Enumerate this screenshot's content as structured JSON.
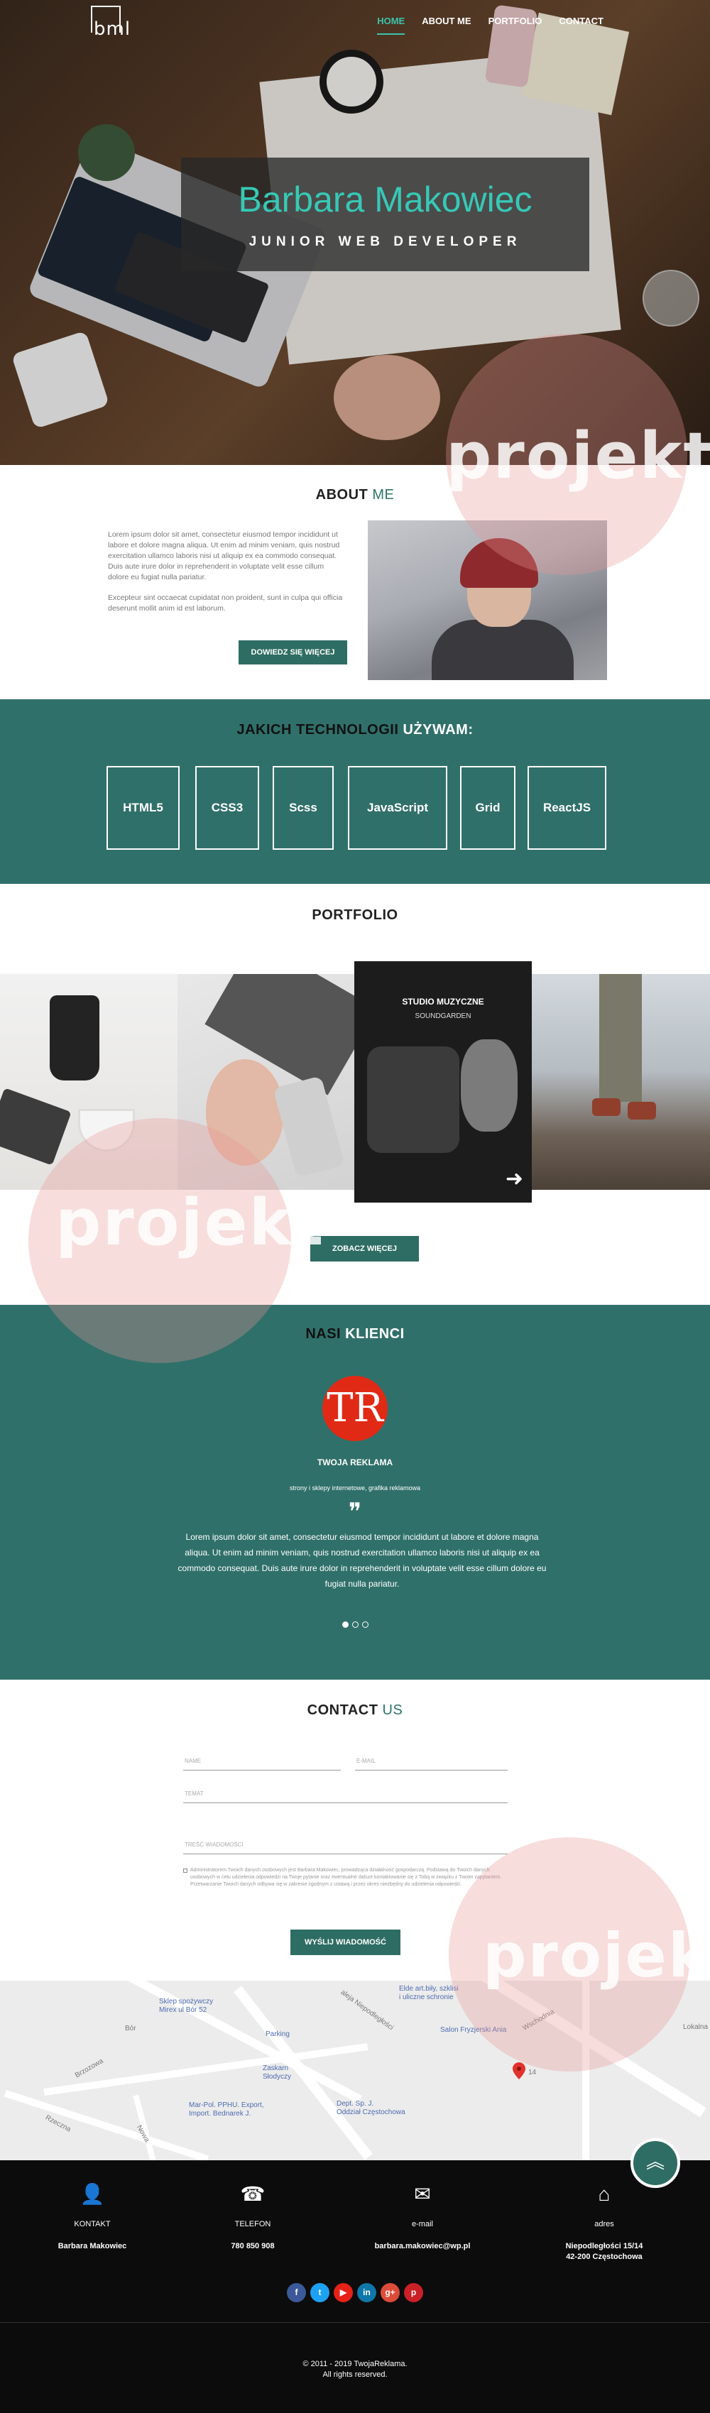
{
  "brand": {
    "logo_text": "bml"
  },
  "nav": {
    "items": [
      {
        "label": "HOME",
        "active": true
      },
      {
        "label": "ABOUT ME",
        "active": false
      },
      {
        "label": "PORTFOLIO",
        "active": false
      },
      {
        "label": "CONTACT",
        "active": false
      }
    ]
  },
  "hero": {
    "name": "Barbara Makowiec",
    "role": "JUNIOR WEB DEVELOPER"
  },
  "watermark": {
    "text": "projekt"
  },
  "about": {
    "title_main": "ABOUT",
    "title_accent": "ME",
    "paragraph_1": "Lorem ipsum dolor sit amet, consectetur eiusmod tempor incididunt ut labore et dolore magna aliqua. Ut enim ad minim veniam, quis nostrud exercitation ullamco laboris nisi ut aliquip ex ea commodo consequat. Duis aute irure dolor in reprehenderit in voluptate velit esse cillum dolore eu fugiat nulla pariatur.",
    "paragraph_2": "Excepteur sint occaecat cupidatat non proident, sunt in culpa qui officia deserunt mollit anim id est laborum.",
    "button_label": "DOWIEDZ SIĘ WIĘCEJ"
  },
  "tech": {
    "title_part_1": "JAKICH TECHNOLOGII",
    "title_part_2": "UŻYWAM:",
    "items": [
      "HTML5",
      "CSS3",
      "Scss",
      "JavaScript",
      "Grid",
      "ReactJS"
    ]
  },
  "portfolio": {
    "title": "PORTFOLIO",
    "featured_title": "STUDIO MUZYCZNE",
    "featured_subtitle": "SOUNDGARDEN",
    "arrow": "➜",
    "button_label": "ZOBACZ WIĘCEJ"
  },
  "clients": {
    "title_part_1": "NASI",
    "title_part_2": "KLIENCI",
    "logo_text": "TR",
    "client_name": "TWOJA REKLAMA",
    "client_desc": "strony i sklepy internetowe, grafika reklamowa",
    "quote_mark": "❞",
    "testimonial": "Lorem ipsum dolor sit amet, consectetur eiusmod tempor incididunt ut labore et dolore magna aliqua. Ut enim ad minim veniam, quis nostrud exercitation ullamco laboris nisi ut aliquip ex ea commodo consequat. Duis aute irure dolor in reprehenderit in voluptate velit esse cillum dolore eu fugiat nulla pariatur.",
    "active_slide": 1,
    "slide_count": 3
  },
  "contact": {
    "title_main": "CONTACT",
    "title_accent": "US",
    "fields": {
      "name": "NAME",
      "email": "E-MAIL",
      "topic": "TEMAT",
      "message": "TREŚĆ WIADOMOŚCI"
    },
    "consent": "Administratorem Twoich danych osobowych jest Barbara Makowiec, prowadząca działalność gospodarczą. Podstawą do Twoich danych osobowych w celu udzielenia odpowiedzi na Twoje pytanie oraz ewentualne dalsze kontaktowanie się z Tobą w związku z Twoim zapytaniem. Przetwarzanie Twoich danych odbywa się w zakresie zgodnym z ustawą i przez okres niezbędny do udzielenia odpowiedzi.",
    "button_label": "WYŚLIJ WIADOMOŚĆ"
  },
  "map": {
    "labels": {
      "store": "Sklep spożywczy\nMirex ul Bór 52",
      "parking": "Parking",
      "zaskarn": "Zaskarn\nSłodyczy",
      "marpol": "Mar-Pol. PPHU. Export,\nImport. Bednarek J.",
      "dept": "Dept. Sp. J.\nOddział Częstochowa",
      "elde": "Elde art.biły, szklisi\ni uliczne schronie",
      "salon": "Salon Fryzjerski Ania",
      "street": "aleja Niepodległości",
      "number": "14",
      "bor": "Bór",
      "lokalne": "Lokalna",
      "brzozowa": "Brzozowa",
      "nowa": "Nowa",
      "rzeczna": "Rzeczna",
      "wschodnia": "Wschodnia"
    }
  },
  "back_to_top": "︽",
  "footer": {
    "columns": [
      {
        "icon": "user-icon",
        "glyph": "👤",
        "label": "KONTAKT",
        "value": "Barbara Makowiec"
      },
      {
        "icon": "phone-icon",
        "glyph": "☎",
        "label": "TELEFON",
        "value": "780 850 908"
      },
      {
        "icon": "email-icon",
        "glyph": "✉",
        "label": "e-mail",
        "value": "barbara.makowiec@wp.pl"
      },
      {
        "icon": "map-icon",
        "glyph": "⌂",
        "label": "adres",
        "value": "Niepodległości 15/14\n42-200 Częstochowa"
      }
    ],
    "social": [
      {
        "name": "facebook-icon",
        "glyph": "f",
        "color": "#3b5998"
      },
      {
        "name": "twitter-icon",
        "glyph": "t",
        "color": "#1da1f2"
      },
      {
        "name": "youtube-icon",
        "glyph": "▶",
        "color": "#e62117"
      },
      {
        "name": "linkedin-icon",
        "glyph": "in",
        "color": "#0e76a8"
      },
      {
        "name": "google-plus-icon",
        "glyph": "g+",
        "color": "#dd4b39"
      },
      {
        "name": "pinterest-icon",
        "glyph": "p",
        "color": "#cb2027"
      }
    ],
    "copyright": "© 2011 - 2019 TwojaReklama.",
    "rights": "All rights reserved."
  },
  "colors": {
    "accent": "#30706a",
    "accent_light": "#36c9b6",
    "brand_red": "#e12a15"
  }
}
